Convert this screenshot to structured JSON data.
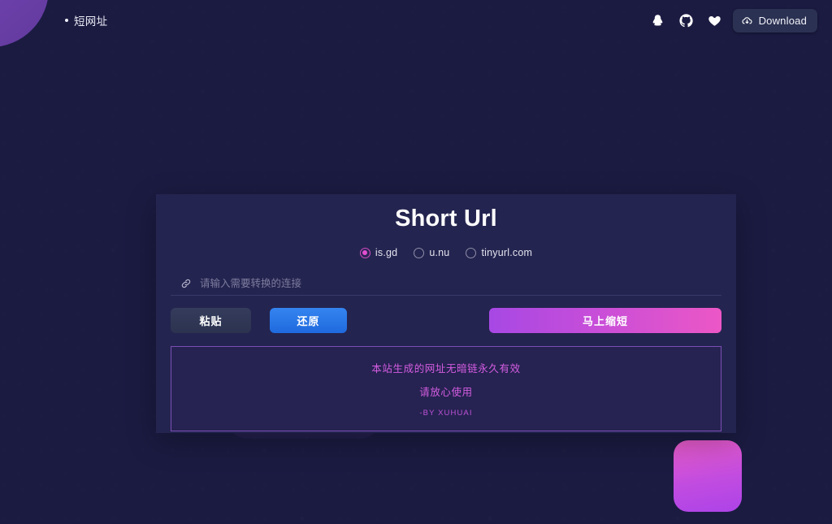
{
  "header": {
    "brand_label": "短网址",
    "brand_bullet_icon": "dot-icon",
    "icons": [
      {
        "name": "qq-icon",
        "label": "QQ"
      },
      {
        "name": "github-icon",
        "label": "GitHub"
      },
      {
        "name": "heart-icon",
        "label": "Sponsor"
      }
    ],
    "download": {
      "label": "Download",
      "icon": "cloud-download-icon"
    }
  },
  "card": {
    "title": "Short Url",
    "providers": [
      {
        "value": "is.gd",
        "label": "is.gd",
        "checked": true
      },
      {
        "value": "u.nu",
        "label": "u.nu",
        "checked": false
      },
      {
        "value": "tinyurl.com",
        "label": "tinyurl.com",
        "checked": false
      }
    ],
    "url_input": {
      "icon": "link-icon",
      "value": "",
      "placeholder": "请输入需要转换的连接"
    },
    "buttons": {
      "paste": "粘贴",
      "restore": "还原",
      "shorten": "马上缩短"
    },
    "notice": {
      "line1": "本站生成的网址无暗链永久有效",
      "line2": "请放心使用",
      "author": "-BY XUHUAI"
    }
  },
  "theme": {
    "background": "#1b1b42",
    "card_background": "#242450",
    "accent_pink": "#e855c8",
    "accent_purple": "#a748e4",
    "accent_blue": "#2f7ae8",
    "notice_border": "#7b4fb4",
    "blob_purple": "#6c3faa"
  }
}
